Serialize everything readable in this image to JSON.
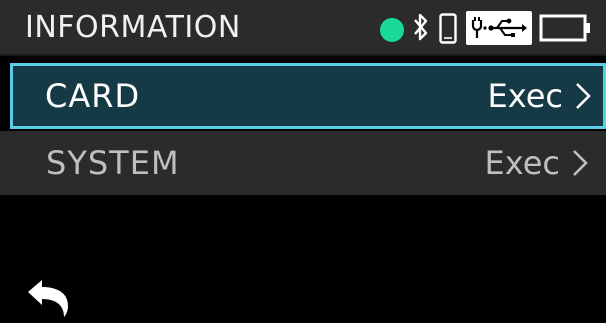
{
  "header": {
    "title": "INFORMATION",
    "status_icons": [
      "status-dot",
      "bluetooth-icon",
      "phone-icon",
      "usb-icon",
      "battery-icon"
    ],
    "status_dot_color": "#19d99a"
  },
  "menu": [
    {
      "label": "CARD",
      "action": "Exec",
      "selected": true
    },
    {
      "label": "SYSTEM",
      "action": "Exec",
      "selected": false
    }
  ],
  "footer": {
    "back_icon": "back-arrow-icon"
  },
  "colors": {
    "selected_bg": "#163a45",
    "selected_border": "#5bcde6",
    "row_bg": "#2b2b2b"
  }
}
